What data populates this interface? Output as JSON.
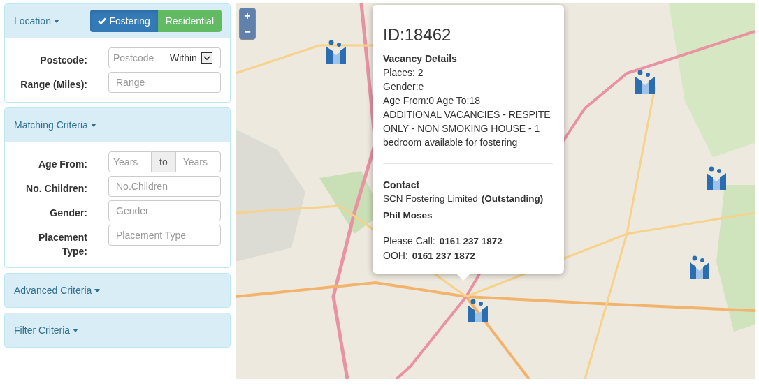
{
  "sidebar": {
    "panels": [
      {
        "title": "Location",
        "expanded": true,
        "toggle": [
          {
            "label": "Fostering",
            "selected": true,
            "color": "#337ab7"
          },
          {
            "label": "Residential",
            "selected": false,
            "color": "#5cb85c"
          }
        ],
        "rows": [
          {
            "kind": "select",
            "label": "Postcode:",
            "placeholder": "Postcode",
            "select_value": "Within"
          },
          {
            "kind": "input",
            "label": "Range (Miles):",
            "placeholder": "Range"
          }
        ]
      },
      {
        "title": "Matching Criteria",
        "expanded": true,
        "rows": [
          {
            "kind": "range",
            "label": "Age From:",
            "placeholder": "Years",
            "addon": "to",
            "placeholder_2": "Years"
          },
          {
            "kind": "input",
            "label": "No. Children:",
            "placeholder": "No.Children"
          },
          {
            "kind": "input",
            "label": "Gender:",
            "placeholder": "Gender"
          },
          {
            "kind": "input",
            "label": "Placement Type:",
            "placeholder": "Placement Type"
          }
        ]
      },
      {
        "title": "Advanced Criteria",
        "expanded": false
      },
      {
        "title": "Filter Criteria",
        "expanded": false
      }
    ]
  },
  "map": {
    "zoom_in": "+",
    "zoom_out": "−",
    "popup": {
      "id": "ID:18462",
      "heading": "Vacancy Details",
      "lines": [
        "Places: 2",
        "Gender:e",
        "Age From:0 Age To:18",
        "ADDITIONAL VACANCIES - RESPITE ONLY - NON SMOKING HOUSE - 1 bedroom available for fostering"
      ],
      "contact_heading": "Contact",
      "organisation": "SCN Fostering Limited",
      "rating": "(Outstanding)",
      "person": "Phil Moses",
      "calls": [
        {
          "label": "Please Call:",
          "number": "0161 237 1872"
        },
        {
          "label": "OOH:",
          "number": "0161 237 1872"
        }
      ]
    }
  }
}
